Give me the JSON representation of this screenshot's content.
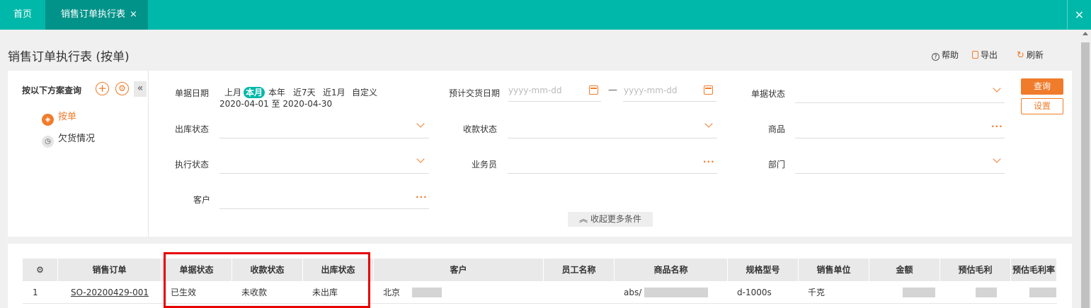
{
  "tabs": {
    "home": "首页",
    "active": "销售订单执行表",
    "close": "×"
  },
  "window_close": "×",
  "page_title": "销售订单执行表 (按单)",
  "toolbar": {
    "help": "帮助",
    "export": "导出",
    "refresh": "刷新",
    "help_icon": "?",
    "refresh_icon": "↻"
  },
  "schemes": {
    "title": "按以下方案查询",
    "add_icon": "+",
    "gear_icon": "⚙",
    "collapse_icon": "«",
    "items": [
      {
        "label": "按单",
        "icon": "◈",
        "active": true
      },
      {
        "label": "欠货情况",
        "icon": "◷",
        "active": false
      }
    ]
  },
  "filters": {
    "doc_date": {
      "label": "单据日期",
      "quick": [
        "上月",
        "本月",
        "本年",
        "近7天",
        "近1月",
        "自定义"
      ],
      "selected": "本月",
      "range": "2020-04-01 至 2020-04-30"
    },
    "delivery_date": {
      "label": "预计交货日期",
      "start_placeholder": "yyyy-mm-dd",
      "end_placeholder": "yyyy-mm-dd",
      "dash": "—"
    },
    "doc_status": {
      "label": "单据状态"
    },
    "out_status": {
      "label": "出库状态"
    },
    "receipt_status": {
      "label": "收款状态"
    },
    "product": {
      "label": "商品"
    },
    "exec_status": {
      "label": "执行状态"
    },
    "salesman": {
      "label": "业务员"
    },
    "department": {
      "label": "部门"
    },
    "customer": {
      "label": "客户"
    },
    "dots": "···"
  },
  "buttons": {
    "query": "查询",
    "settings": "设置",
    "more": "收起更多条件",
    "more_icon": "︽"
  },
  "table": {
    "gear_icon": "⚙",
    "columns": [
      "销售订单",
      "单据状态",
      "收款状态",
      "出库状态",
      "客户",
      "员工名称",
      "商品名称",
      "规格型号",
      "销售单位",
      "金额",
      "预估毛利",
      "预估毛利率"
    ],
    "rows": [
      {
        "index": "1",
        "order_no": "SO-20200429-001",
        "doc_status": "已生效",
        "receipt_status": "未收款",
        "out_status": "未出库",
        "customer": "北京",
        "employee": "",
        "product": "abs/",
        "spec": "d-1000s",
        "unit": "千克",
        "amount": "",
        "profit": "",
        "profit_rate": ""
      }
    ]
  },
  "colors": {
    "teal": "#00b8a9",
    "teal_dark": "#019389",
    "accent": "#f07c2b",
    "highlight": "#e60000"
  }
}
